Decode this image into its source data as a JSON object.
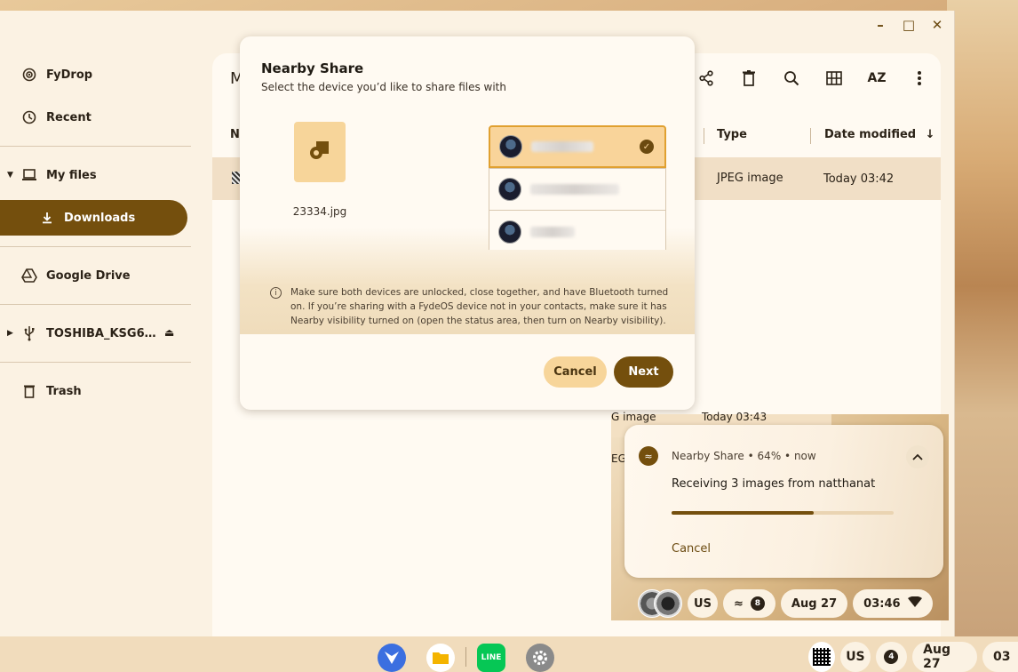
{
  "window": {
    "minimize_label": "–",
    "maximize_label": "□",
    "close_label": "✕"
  },
  "sidebar": {
    "items": [
      {
        "label": "FyDrop",
        "icon": "podcast-icon"
      },
      {
        "label": "Recent",
        "icon": "clock-icon"
      },
      {
        "label": "My files",
        "icon": "laptop-icon"
      },
      {
        "label": "Downloads",
        "icon": "download-icon"
      },
      {
        "label": "Google Drive",
        "icon": "drive-icon"
      },
      {
        "label": "TOSHIBA_KSG6…",
        "icon": "usb-icon"
      },
      {
        "label": "Trash",
        "icon": "trash-icon"
      }
    ]
  },
  "main": {
    "title_partial": "M",
    "columns": {
      "name_partial": "N",
      "type": "Type",
      "date_modified": "Date modified"
    },
    "rows": [
      {
        "type": "JPEG image",
        "date": "Today 03:42"
      },
      {
        "type_partial": "G image",
        "date": "Today 03:43"
      },
      {
        "type_partial": "EG"
      }
    ],
    "toolbar_icons": [
      "share-icon",
      "delete-icon",
      "search-icon",
      "grid-view-icon",
      "sort-az-icon",
      "more-icon"
    ],
    "sort_label": "AZ"
  },
  "dialog": {
    "title": "Nearby Share",
    "subtitle": "Select the device you’d like to share files with",
    "file_name": "23334.jpg",
    "info_text": "Make sure both devices are unlocked, close together, and have Bluetooth turned on. If you’re sharing with a FydeOS device not in your contacts, make sure it has Nearby visibility turned on (open the status area, then turn on Nearby visibility).",
    "cancel_label": "Cancel",
    "next_label": "Next"
  },
  "notification": {
    "app": "Nearby Share",
    "percent": "64%",
    "time": "now",
    "separator": "•",
    "message": "Receiving 3 images from natthanat",
    "progress": 0.64,
    "cancel_label": "Cancel"
  },
  "tray": {
    "keyboard": "US",
    "notif_count": "8",
    "date": "Aug 27",
    "time": "03:46"
  },
  "shelf": {
    "keyboard": "US",
    "notif_count": "4",
    "date": "Aug 27",
    "time_partial": "03"
  },
  "colors": {
    "accent": "#744f0d",
    "accent_light": "#f7d59a",
    "surface": "#fffaf2"
  }
}
